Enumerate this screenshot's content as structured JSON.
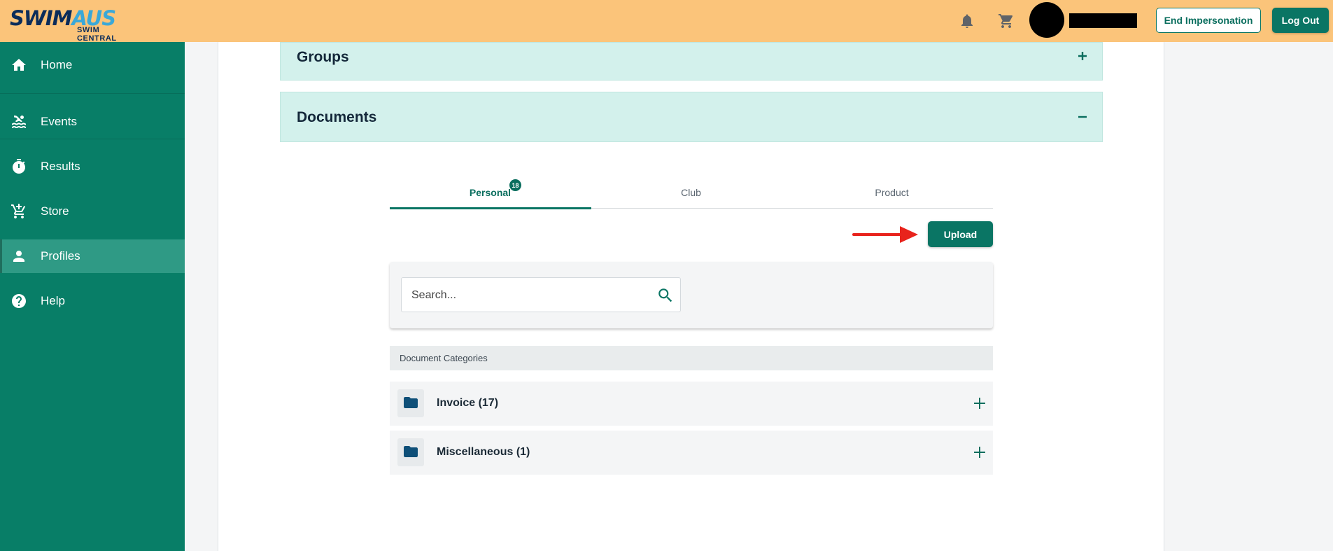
{
  "header": {
    "logo": {
      "main_part1": "SWIM",
      "main_part2": "AUS",
      "sub": "SWIM CENTRAL"
    },
    "notification_icon": "bell-icon",
    "cart_icon": "cart-icon",
    "end_impersonation_label": "End Impersonation",
    "logout_label": "Log Out"
  },
  "sidebar": {
    "items": [
      {
        "label": "Home",
        "icon": "home-icon"
      },
      {
        "label": "Events",
        "icon": "swimmer-icon"
      },
      {
        "label": "Results",
        "icon": "stopwatch-icon"
      },
      {
        "label": "Store",
        "icon": "cart-plus-icon"
      },
      {
        "label": "Profiles",
        "icon": "person-icon",
        "active": true
      },
      {
        "label": "Help",
        "icon": "help-icon"
      }
    ]
  },
  "main": {
    "groups": {
      "title": "Groups",
      "state": "collapsed"
    },
    "documents": {
      "title": "Documents",
      "state": "expanded",
      "tabs": [
        {
          "label": "Personal",
          "badge": "18",
          "active": true
        },
        {
          "label": "Club"
        },
        {
          "label": "Product"
        }
      ],
      "upload_label": "Upload",
      "search_placeholder": "Search...",
      "categories_header": "Document Categories",
      "categories": [
        {
          "label": "Invoice (17)"
        },
        {
          "label": "Miscellaneous (1)"
        }
      ]
    }
  },
  "colors": {
    "header_bg": "#fbc47a",
    "sidebar_bg": "#087e67",
    "accent": "#0a7564",
    "accordion_bg": "#d3f1ec",
    "annotation_arrow": "#e8231c"
  }
}
